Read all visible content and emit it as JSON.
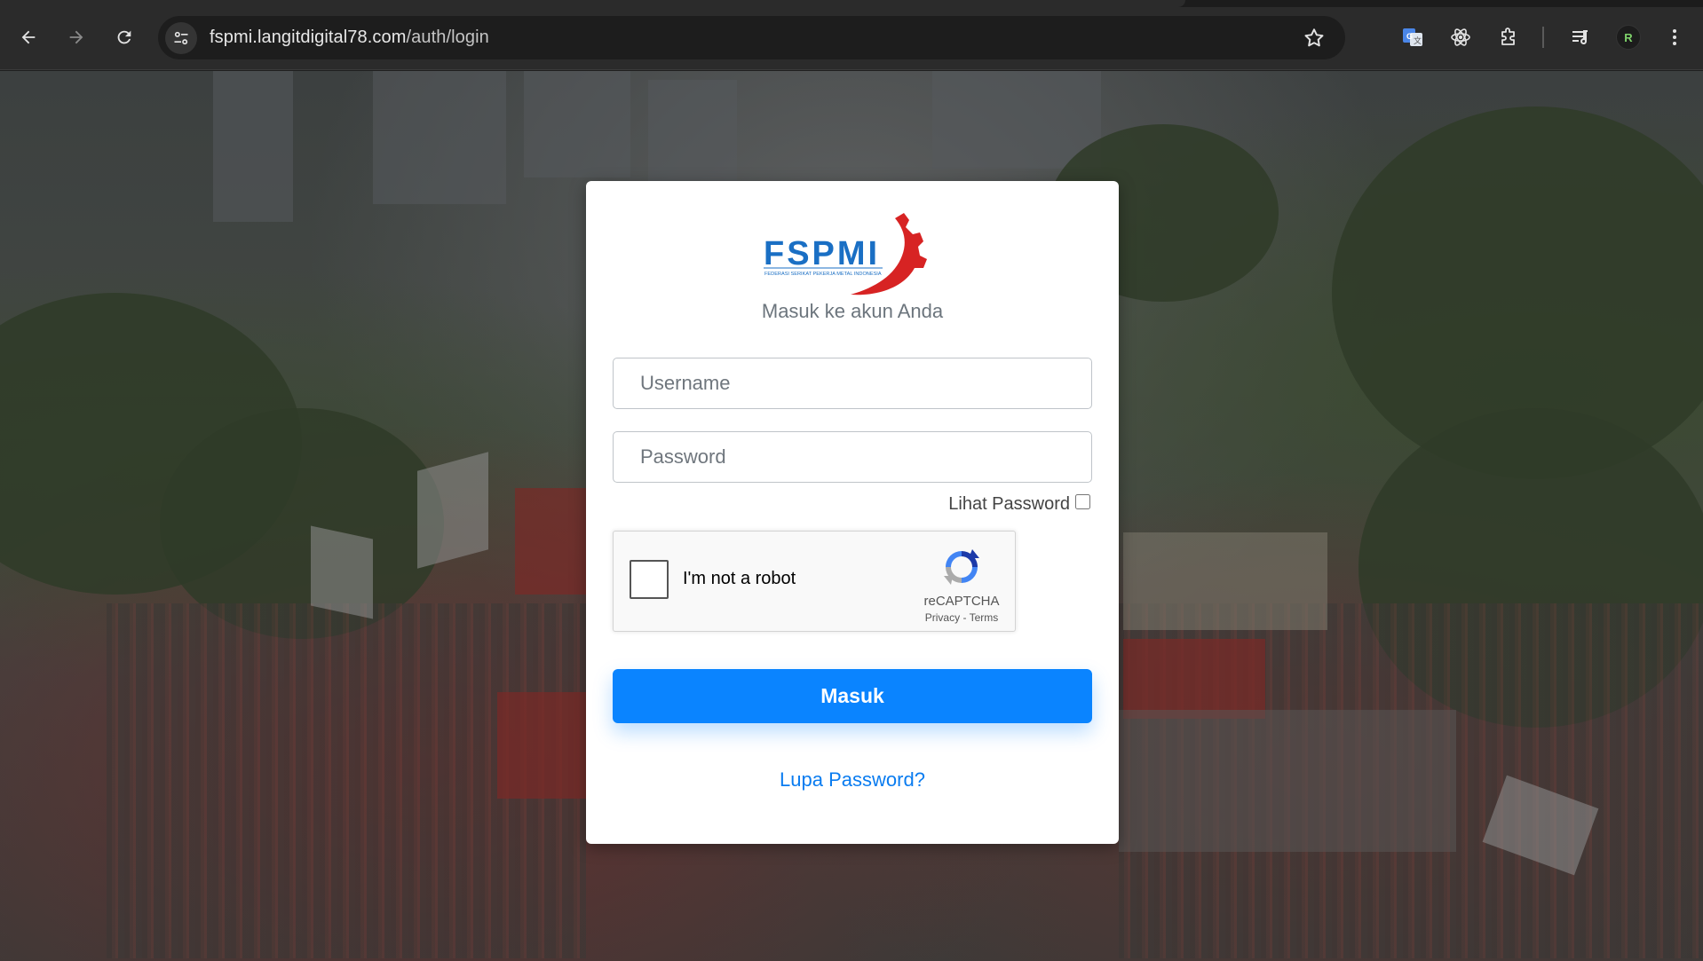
{
  "browser": {
    "url_host": "fspmi.langitdigital78.com",
    "url_path": "/auth/login",
    "profile_initial": "R",
    "icons": [
      "back-icon",
      "forward-icon",
      "reload-icon",
      "site-info-icon",
      "bookmark-star-icon",
      "google-translate-icon",
      "react-devtools-icon",
      "extensions-icon",
      "media-controls-icon",
      "profile-avatar",
      "menu-icon"
    ]
  },
  "login": {
    "logo_text": "FSPMI",
    "logo_subtext": "FEDERASI SERIKAT PEKERJA METAL INDONESIA",
    "subtitle": "Masuk ke akun Anda",
    "username_placeholder": "Username",
    "password_placeholder": "Password",
    "show_password_label": "Lihat Password",
    "recaptcha": {
      "label": "I'm not a robot",
      "brand": "reCAPTCHA",
      "privacy": "Privacy",
      "separator": "-",
      "terms": "Terms"
    },
    "submit_label": "Masuk",
    "forgot_label": "Lupa Password?"
  },
  "colors": {
    "primary": "#0a84ff",
    "link": "#0a7cf0",
    "subtitle": "#6c757d",
    "logo_blue": "#1a6fc4",
    "logo_red": "#d72323"
  }
}
